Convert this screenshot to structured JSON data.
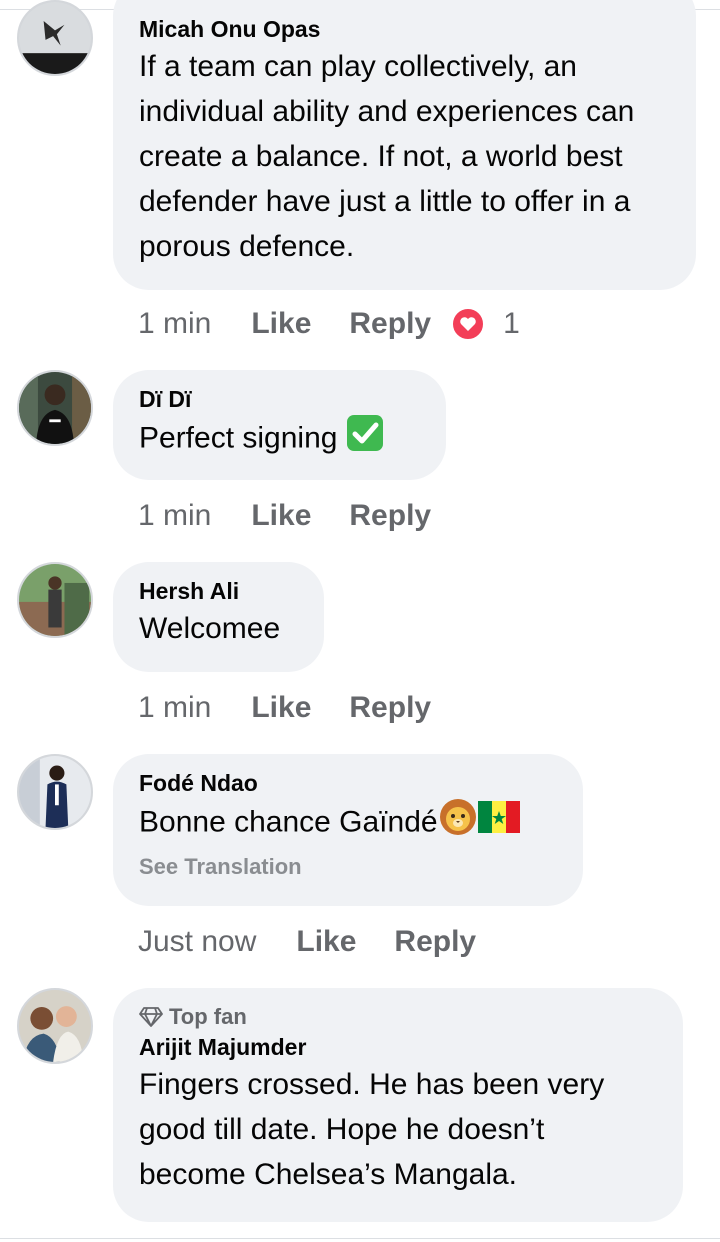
{
  "comments": [
    {
      "author": "Micah Onu Opas",
      "text": "If a team can play collectively, an individual ability and experiences can create a balance. If not, a world best defender have just a little to offer in a porous defence.",
      "time": "1 min",
      "like_label": "Like",
      "reply_label": "Reply",
      "reaction": {
        "icon": "love-reaction-icon",
        "count": "1"
      }
    },
    {
      "author": "Dï Dï",
      "text": "Perfect signing",
      "text_emoji": "check-mark-button-emoji",
      "time": "1 min",
      "like_label": "Like",
      "reply_label": "Reply"
    },
    {
      "author": "Hersh Ali",
      "text": "Welcomee",
      "time": "1 min",
      "like_label": "Like",
      "reply_label": "Reply"
    },
    {
      "author": "Fodé Ndao",
      "text": "Bonne chance Gaïndé",
      "text_emoji": [
        "lion-face-emoji",
        "senegal-flag-emoji"
      ],
      "see_translation": "See Translation",
      "time": "Just now",
      "like_label": "Like",
      "reply_label": "Reply"
    },
    {
      "badge": "Top fan",
      "author": "Arijit Majumder",
      "text": "Fingers crossed. He has been very good till date. Hope he doesn’t become Chelsea’s Mangala."
    }
  ],
  "colors": {
    "bubble_bg": "#f0f2f5",
    "meta_text": "#65676b",
    "love_reaction": "#f33e58",
    "check_green": "#3fb950"
  }
}
